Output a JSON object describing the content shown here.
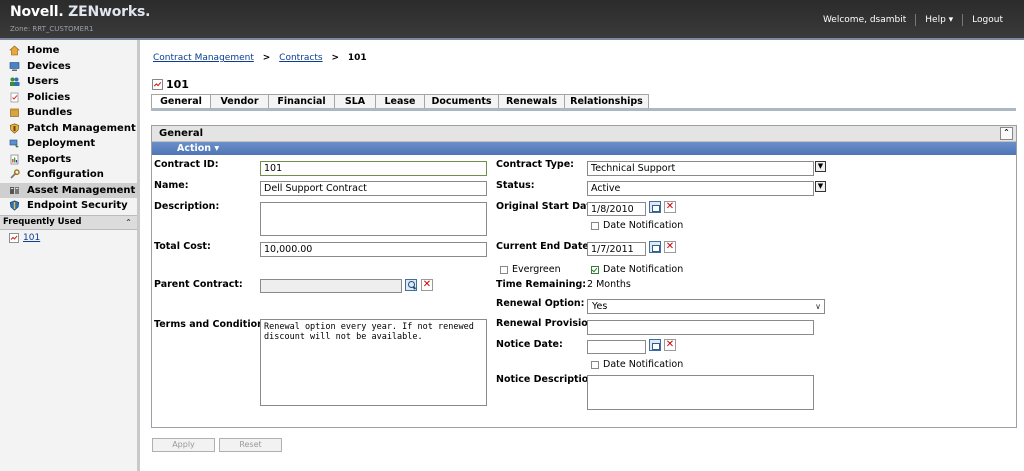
{
  "header": {
    "brand_novell": "Novell.",
    "brand_zenworks": "ZENworks.",
    "zone": "Zone: RRT_CUSTOMER1",
    "welcome": "Welcome, dsambit",
    "help": "Help ▾",
    "logout": "Logout"
  },
  "sidebar": {
    "items": [
      {
        "label": "Home",
        "icon": "home-icon"
      },
      {
        "label": "Devices",
        "icon": "devices-icon"
      },
      {
        "label": "Users",
        "icon": "users-icon"
      },
      {
        "label": "Policies",
        "icon": "policies-icon"
      },
      {
        "label": "Bundles",
        "icon": "bundles-icon"
      },
      {
        "label": "Patch Management",
        "icon": "patch-icon"
      },
      {
        "label": "Deployment",
        "icon": "deployment-icon"
      },
      {
        "label": "Reports",
        "icon": "reports-icon"
      },
      {
        "label": "Configuration",
        "icon": "configuration-icon"
      },
      {
        "label": "Asset Management",
        "icon": "asset-icon"
      },
      {
        "label": "Endpoint Security",
        "icon": "endpoint-icon"
      }
    ],
    "active_index": 9,
    "frequently_used_title": "Frequently Used",
    "frequently_used": [
      "101"
    ]
  },
  "breadcrumb": {
    "contract_management": "Contract Management",
    "contracts": "Contracts",
    "current": "101",
    "sep": ">"
  },
  "page_title": "101",
  "tabs": [
    "General",
    "Vendor",
    "Financial",
    "SLA",
    "Lease",
    "Documents",
    "Renewals",
    "Relationships"
  ],
  "panel": {
    "title": "General",
    "action": "Action ▾"
  },
  "form": {
    "contract_id_label": "Contract ID:",
    "contract_id": "101",
    "name_label": "Name:",
    "name": "Dell Support Contract",
    "description_label": "Description:",
    "description": "",
    "total_cost_label": "Total Cost:",
    "total_cost": "10,000.00",
    "parent_contract_label": "Parent Contract:",
    "parent_contract": "",
    "terms_label": "Terms and Conditions:",
    "terms": "Renewal option every year. If not renewed\ndiscount will not be available.",
    "contract_type_label": "Contract Type:",
    "contract_type": "Technical Support",
    "status_label": "Status:",
    "status": "Active",
    "original_start_label": "Original Start Date:",
    "original_start": "1/8/2010",
    "date_notification": "Date Notification",
    "current_end_label": "Current End Date:",
    "current_end": "1/7/2011",
    "evergreen": "Evergreen",
    "time_remaining_label": "Time Remaining:",
    "time_remaining": "2 Months",
    "renewal_option_label": "Renewal Option:",
    "renewal_option": "Yes",
    "renewal_provision_label": "Renewal Provision:",
    "renewal_provision": "",
    "notice_date_label": "Notice Date:",
    "notice_date": "",
    "notice_description_label": "Notice Description:",
    "notice_description": ""
  },
  "checkboxes": {
    "start_date_notification": false,
    "evergreen": false,
    "end_date_notification": true,
    "notice_date_notification": false
  },
  "buttons": {
    "apply": "Apply",
    "reset": "Reset"
  }
}
